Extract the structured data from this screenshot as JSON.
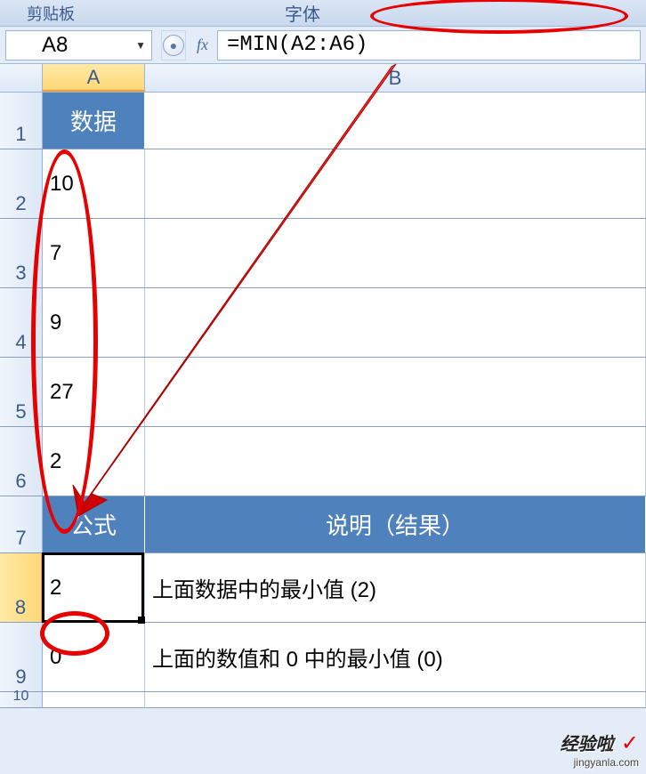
{
  "ribbon": {
    "clipboard_label": "剪贴板",
    "font_label": "字体"
  },
  "formula_bar": {
    "name_box": "A8",
    "fx_label": "fx",
    "formula": "=MIN(A2:A6)"
  },
  "columns": {
    "a": "A",
    "b": "B"
  },
  "rows": [
    "1",
    "2",
    "3",
    "4",
    "5",
    "6",
    "7",
    "8",
    "9",
    "10"
  ],
  "headers": {
    "data": "数据",
    "formula": "公式",
    "desc": "说明（结果）"
  },
  "data_values": [
    "10",
    "7",
    "9",
    "27",
    "2"
  ],
  "results": [
    {
      "value": "2",
      "desc": "上面数据中的最小值 (2)"
    },
    {
      "value": "0",
      "desc": "上面的数值和 0 中的最小值 (0)"
    }
  ],
  "watermark": {
    "main": "经验啦",
    "check": "✓",
    "sub": "jingyanla.com"
  }
}
